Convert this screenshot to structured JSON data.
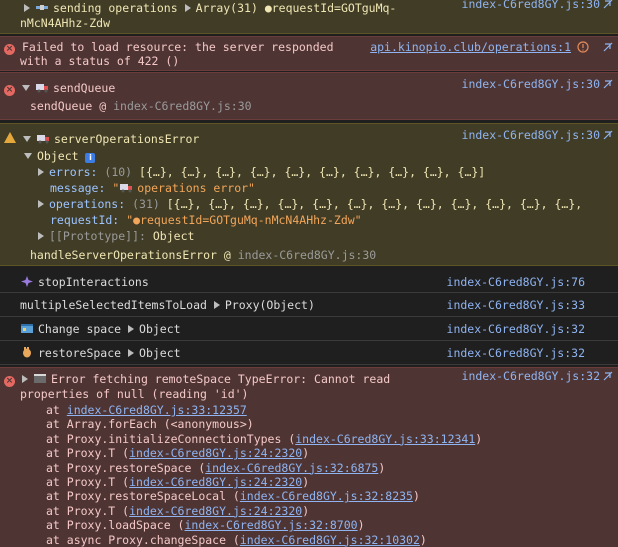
{
  "m1": {
    "line1": "sending operations",
    "array": "Array(31)",
    "req": "●requestId=GOTguMq-",
    "line2": "nMcN4AHhz-Zdw",
    "src": "index-C6red8GY.js:30"
  },
  "m2": {
    "line1": "Failed to load resource: the server responded",
    "line2": "with a status of 422 ()",
    "src": "api.kinopio.club/operations:1"
  },
  "m3": {
    "title": "sendQueue",
    "src": "index-C6red8GY.js:30",
    "trace_fn": "sendQueue @ ",
    "trace_src": "index-C6red8GY.js:30"
  },
  "m4": {
    "title": "serverOperationsError",
    "src": "index-C6red8GY.js:30",
    "object": "Object",
    "errors_key": "errors:",
    "errors_count": "(10)",
    "errors_val": "[{…}, {…}, {…}, {…}, {…}, {…}, {…}, {…}, {…}, {…}]",
    "message_key": "message:",
    "message_val": "operations error\"",
    "message_open": "\"",
    "ops_key": "operations:",
    "ops_count": "(31)",
    "ops_val": "[{…}, {…}, {…}, {…}, {…}, {…}, {…}, {…}, {…}, {…}, {…}, {…},",
    "req_key": "requestId:",
    "req_val": "\"●requestId=GOTguMq-nMcN4AHhz-Zdw\"",
    "proto_key": "[[Prototype]]:",
    "proto_val": "Object",
    "trace_fn": "handleServerOperationsError @ ",
    "trace_src": "index-C6red8GY.js:30"
  },
  "m5": {
    "text": "stopInteractions",
    "src": "index-C6red8GY.js:76"
  },
  "m6": {
    "text": "multipleSelectedItemsToLoad",
    "proxy": "Proxy(Object)",
    "src": "index-C6red8GY.js:33"
  },
  "m7": {
    "text": "Change space",
    "obj": "Object",
    "src": "index-C6red8GY.js:32"
  },
  "m8": {
    "text": "restoreSpace",
    "obj": "Object",
    "src": "index-C6red8GY.js:32"
  },
  "m9": {
    "line1": "Error fetching remoteSpace TypeError: Cannot read",
    "line2": "properties of null (reading 'id')",
    "src": "index-C6red8GY.js:32",
    "stack": [
      {
        "pre": "at ",
        "link": "index-C6red8GY.js:33:12357",
        "post": ""
      },
      {
        "pre": "at Array.forEach (<anonymous>)",
        "link": "",
        "post": ""
      },
      {
        "pre": "at Proxy.initializeConnectionTypes (",
        "link": "index-C6red8GY.js:33:12341",
        "post": ")"
      },
      {
        "pre": "at Proxy.T (",
        "link": "index-C6red8GY.js:24:2320",
        "post": ")"
      },
      {
        "pre": "at Proxy.restoreSpace (",
        "link": "index-C6red8GY.js:32:6875",
        "post": ")"
      },
      {
        "pre": "at Proxy.T (",
        "link": "index-C6red8GY.js:24:2320",
        "post": ")"
      },
      {
        "pre": "at Proxy.restoreSpaceLocal (",
        "link": "index-C6red8GY.js:32:8235",
        "post": ")"
      },
      {
        "pre": "at Proxy.T (",
        "link": "index-C6red8GY.js:24:2320",
        "post": ")"
      },
      {
        "pre": "at Proxy.loadSpace (",
        "link": "index-C6red8GY.js:32:8700",
        "post": ")"
      },
      {
        "pre": "at async Proxy.changeSpace (",
        "link": "index-C6red8GY.js:32:10302",
        "post": ")"
      }
    ]
  }
}
